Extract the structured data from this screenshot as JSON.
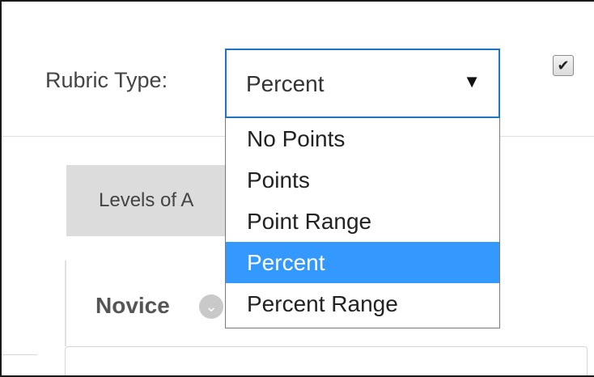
{
  "rubric_type": {
    "label": "Rubric Type:",
    "selected_value": "Percent",
    "arrow_icon": "▼",
    "options": [
      "No Points",
      "Points",
      "Point Range",
      "Percent",
      "Percent Range"
    ],
    "selected_index": 3
  },
  "checkbox": {
    "checked": true,
    "glyph": "✔"
  },
  "levels": {
    "tab_label": "Levels of A"
  },
  "level_column": {
    "title": "Novice",
    "icon": "chevron-down-icon"
  },
  "colors": {
    "focus_border": "#1f73c2",
    "selected_option_bg": "#3399ff",
    "tab_bg": "#dcdcdc"
  }
}
